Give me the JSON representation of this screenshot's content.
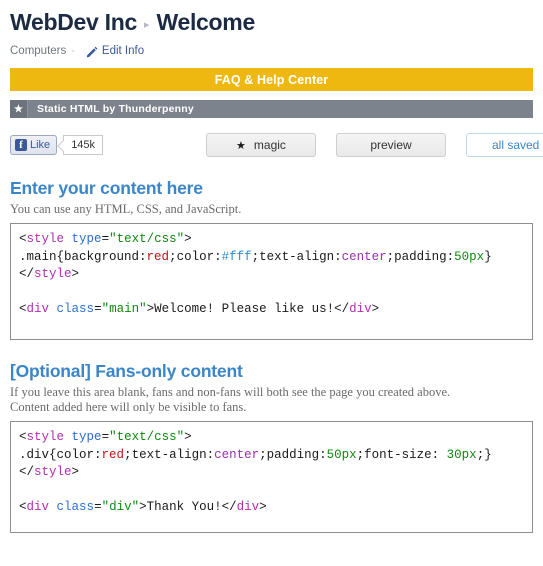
{
  "header": {
    "page_title": "WebDev Inc",
    "arrow": "▸",
    "tab_title": "Welcome",
    "category": "Computers",
    "separator": "·",
    "edit_link": "Edit Info"
  },
  "faq_bar": {
    "label": "FAQ & Help Center"
  },
  "app_bar": {
    "star": "★",
    "title": "Static HTML by Thunderpenny"
  },
  "toolbar": {
    "like_label": "Like",
    "like_glyph": "f",
    "like_count": "145k",
    "magic_star": "★",
    "magic_label": "magic",
    "preview_label": "preview",
    "saved_label": "all saved :)"
  },
  "content_section": {
    "title": "Enter your content here",
    "description": "You can use any HTML, CSS, and JavaScript.",
    "code": {
      "line1": {
        "open_lt": "<",
        "tag": "style",
        "attr": "type",
        "eq": "=",
        "str": "\"text/css\"",
        "close_gt": ">"
      },
      "line2": {
        "selector": ".main{",
        "prop1": "background:",
        "val1": "red",
        "semi1": ";",
        "prop2": "color:",
        "val2": "#fff",
        "semi2": ";",
        "prop3": "text-align:",
        "val3": "center",
        "semi3": ";",
        "prop4": "padding:",
        "val4": "50px",
        "brace": "}"
      },
      "line3": {
        "open": "</",
        "tag": "style",
        "close_gt": ">"
      },
      "line5": {
        "open_lt": "<",
        "tag": "div",
        "attr": "class",
        "eq": "=",
        "str": "\"main\"",
        "gt": ">",
        "text": "Welcome! Please like us!",
        "close_open": "</",
        "close_tag": "div",
        "close_gt": ">"
      }
    }
  },
  "fans_section": {
    "title": "[Optional] Fans-only content",
    "description_line1": "If you leave this area blank, fans and non-fans will both see the page you created above.",
    "description_line2": "Content added here will only be visible to fans.",
    "code": {
      "line1": {
        "open_lt": "<",
        "tag": "style",
        "attr": "type",
        "eq": "=",
        "str": "\"text/css\"",
        "close_gt": ">"
      },
      "line2": {
        "selector": ".div{",
        "prop1": "color:",
        "val1": "red",
        "semi1": ";",
        "prop2": "text-align:",
        "val2": "center",
        "semi2": ";",
        "prop3": "padding:",
        "val3": "50px",
        "semi3": ";",
        "prop4": "font-size: ",
        "val4": "30px",
        "semi4": ";",
        "brace": "}"
      },
      "line3": {
        "open": "</",
        "tag": "style",
        "close_gt": ">"
      },
      "line5": {
        "open_lt": "<",
        "tag": "div",
        "attr": "class",
        "eq": "=",
        "str": "\"div\"",
        "gt": ">",
        "text": "Thank You!",
        "close_open": "</",
        "close_tag": "div",
        "close_gt": ">"
      }
    }
  },
  "colors": {
    "accent_yellow": "#efb810",
    "app_bar_gray": "#7c838d",
    "heading_blue": "#3b86c8",
    "facebook_blue": "#3b5998",
    "title_navy": "#1c2b43"
  }
}
